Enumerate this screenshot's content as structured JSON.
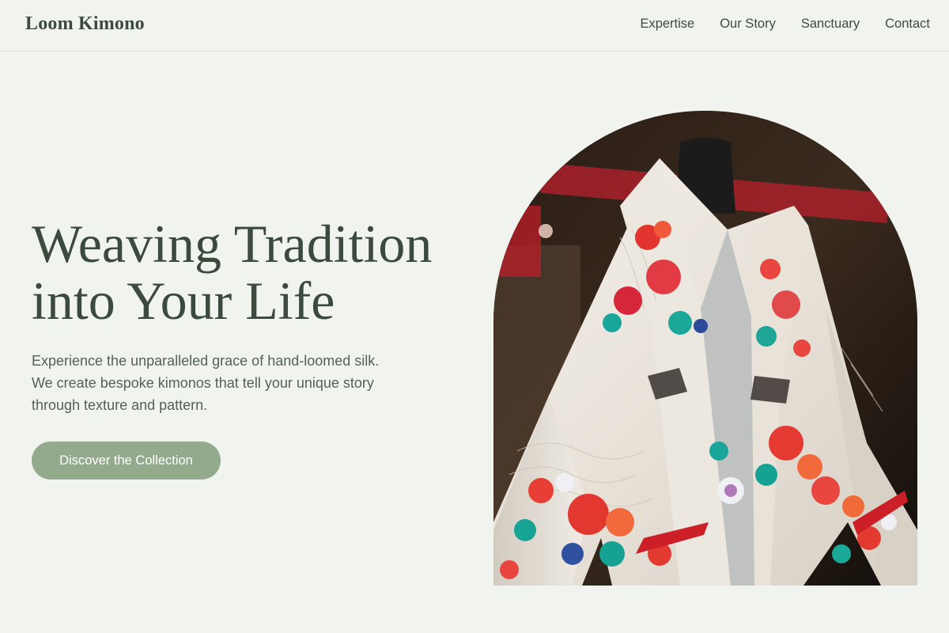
{
  "header": {
    "brand": "Loom Kimono",
    "nav": [
      "Expertise",
      "Our Story",
      "Sanctuary",
      "Contact"
    ]
  },
  "hero": {
    "title_line1": "Weaving Tradition",
    "title_line2": "into Your Life",
    "description": "Experience the unparalleled grace of hand-loomed silk. We create bespoke kimonos that tell your unique story through texture and pattern.",
    "cta_label": "Discover the Collection"
  },
  "colors": {
    "background": "#f0f3ee",
    "text": "#3c4a3e",
    "accent": "#93aa8c"
  }
}
